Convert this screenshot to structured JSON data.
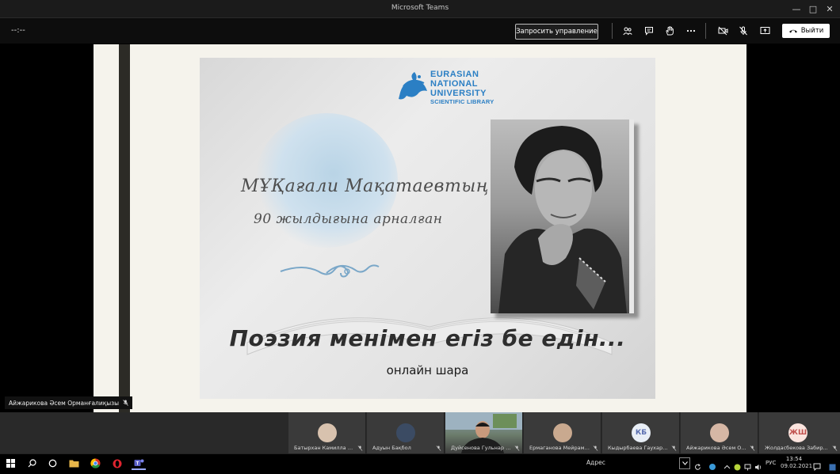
{
  "window": {
    "title": "Microsoft Teams"
  },
  "call": {
    "timer": "--:--",
    "request_control_label": "Запросить управление",
    "leave_label": "Выйти"
  },
  "slide": {
    "logo_lines": [
      "EURASIAN",
      "NATIONAL",
      "UNIVERSITY",
      "SCIENTIFIC LIBRARY"
    ],
    "heading_line1": "МҰҚағали Мақатаевтың",
    "heading_line2": "90 жылдығына арналған",
    "main_title": "Поэзия менімен егіз бе едін...",
    "subtitle": "онлайн шара"
  },
  "presenter": {
    "name": "Айжарикова Әсем Орманғалиқызы"
  },
  "participants": [
    {
      "name": "Батырхан Камилла Р...",
      "initials": ""
    },
    {
      "name": "Адуын Бақбол",
      "initials": ""
    },
    {
      "name": "Дуйсенова Гульнар Г...",
      "initials": ""
    },
    {
      "name": "Ермаганова Мейрамг...",
      "initials": ""
    },
    {
      "name": "Кыдырбаева Гаухар Б...",
      "initials": "КБ"
    },
    {
      "name": "Айжарикова Әсем О...",
      "initials": ""
    },
    {
      "name": "Жолдасбекова Забир...",
      "initials": "ЖШ"
    }
  ],
  "taskbar": {
    "address_label": "Адрес",
    "language": "РУС",
    "time": "13:54",
    "date": "09.02.2021"
  },
  "colors": {
    "accent": "#2b7fc4",
    "leave_bg": "#ffffff",
    "bar_bg": "#0d0d0d"
  }
}
